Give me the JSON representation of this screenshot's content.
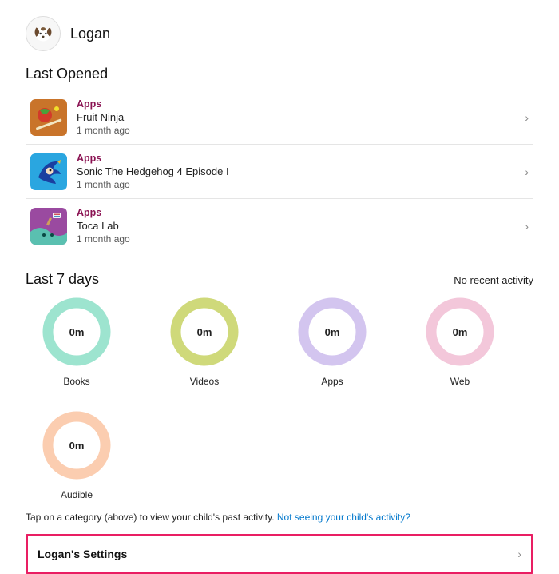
{
  "profile": {
    "name": "Logan"
  },
  "last_opened": {
    "title": "Last Opened",
    "items": [
      {
        "category": "Apps",
        "title": "Fruit Ninja",
        "time": "1 month ago"
      },
      {
        "category": "Apps",
        "title": "Sonic The Hedgehog 4 Episode I",
        "time": "1 month ago"
      },
      {
        "category": "Apps",
        "title": "Toca Lab",
        "time": "1 month ago"
      }
    ]
  },
  "last7": {
    "title": "Last 7 days",
    "no_activity": "No recent activity",
    "rings": [
      {
        "label": "Books",
        "value": "0m",
        "color": "#9de4cf"
      },
      {
        "label": "Videos",
        "value": "0m",
        "color": "#cfd97a"
      },
      {
        "label": "Apps",
        "value": "0m",
        "color": "#d3c5ef"
      },
      {
        "label": "Web",
        "value": "0m",
        "color": "#f3c7da"
      },
      {
        "label": "Audible",
        "value": "0m",
        "color": "#fbcdb0"
      }
    ]
  },
  "hint": {
    "text": "Tap on a category (above) to view your child's past activity. ",
    "link_text": "Not seeing your child's activity?"
  },
  "settings": {
    "label": "Logan's Settings"
  }
}
